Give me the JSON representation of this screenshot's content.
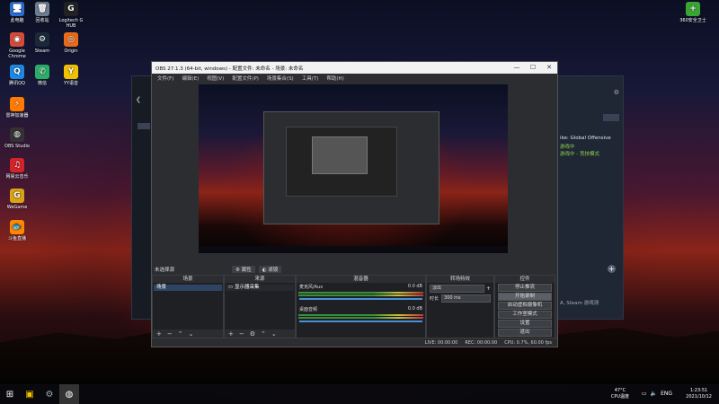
{
  "desktop_icons": [
    {
      "label": "此电脑",
      "glyph": "🖥",
      "color": "#2a6fd6"
    },
    {
      "label": "回收站",
      "glyph": "🗑",
      "color": "#6f7d90"
    },
    {
      "label": "Logitech G HUB",
      "glyph": "G",
      "color": "#222"
    },
    {
      "label": "Google Chrome",
      "glyph": "◉",
      "color": "#d64a3a"
    },
    {
      "label": "Steam",
      "glyph": "⚙",
      "color": "#1b2838"
    },
    {
      "label": "Origin",
      "glyph": "◎",
      "color": "#e86a1a"
    },
    {
      "label": "腾讯QQ",
      "glyph": "Q",
      "color": "#1e88e5"
    },
    {
      "label": "微信",
      "glyph": "✆",
      "color": "#2aae67"
    },
    {
      "label": "YY语音",
      "glyph": "Y",
      "color": "#f2c200"
    },
    {
      "label": "雷神加速器",
      "glyph": "⚡",
      "color": "#ff7a00"
    },
    {
      "label": "OBS Studio",
      "glyph": "◍",
      "color": "#333"
    },
    {
      "label": "网易云音乐",
      "glyph": "♫",
      "color": "#d4242a"
    },
    {
      "label": "WeGame",
      "glyph": "G",
      "color": "#d9a316"
    },
    {
      "label": "斗鱼直播",
      "glyph": "🐟",
      "color": "#ff8a00"
    },
    {
      "label": "360安全卫士",
      "glyph": "+",
      "color": "#3aa535"
    }
  ],
  "steam": {
    "game_title": "ike: Global Offensive",
    "status_line": "游戏中",
    "status_sub": "游戏中 - 竞技模式",
    "friend_note": "A, Steam 游戏测"
  },
  "obs": {
    "title": "OBS 27.1.3 (64-bit, windows) - 配置文件: 未命名 - 场景: 未命名",
    "menu": [
      "文件(F)",
      "编辑(E)",
      "视图(V)",
      "配置文件(P)",
      "场景集合(S)",
      "工具(T)",
      "帮助(H)"
    ],
    "no_source": "未选择源",
    "props_label": "属性",
    "filters_label": "滤镜",
    "scenes_header": "场景",
    "scene_item": "场景",
    "sources_header": "来源",
    "source_item": "显示器采集",
    "mixer_header": "混音器",
    "mixer": [
      {
        "name": "桌面音频",
        "db": "0.0 dB"
      },
      {
        "name": "麦克风/Aux",
        "db": "0.0 dB"
      }
    ],
    "transitions_header": "转场特效",
    "transition_type": "淡出",
    "duration_label": "时长",
    "duration_value": "300 ms",
    "controls_header": "控件",
    "controls": [
      "停止推流",
      "开始录制",
      "启动虚拟摄像机",
      "工作室模式",
      "设置",
      "退出"
    ],
    "status": {
      "live": "LIVE: 00:00:00",
      "rec": "REC: 00:00:00",
      "cpu": "CPU: 0.7%, 60.00 fps"
    }
  },
  "taskbar": {
    "temp": "47°C",
    "temp_label": "CPU温度",
    "lang": "ENG",
    "time": "1:23:51",
    "date": "2021/10/12"
  }
}
